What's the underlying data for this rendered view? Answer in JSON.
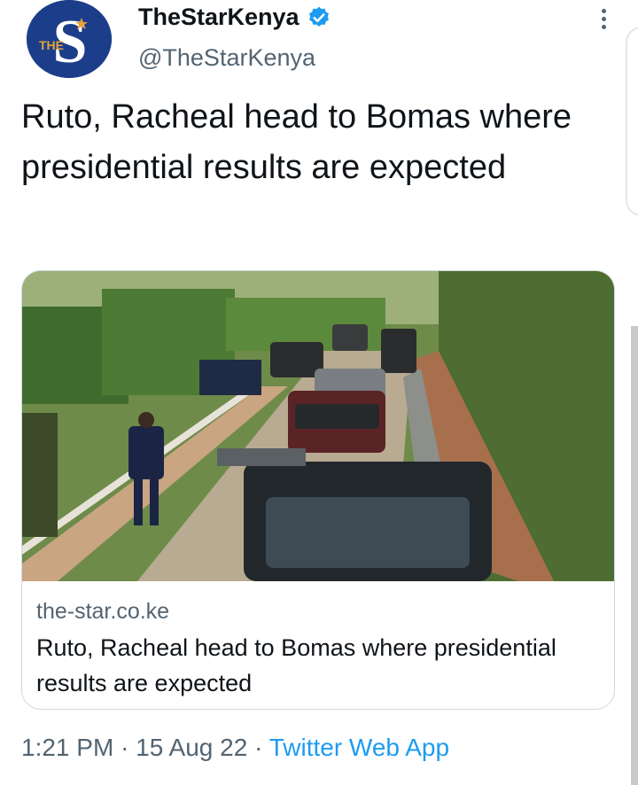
{
  "author": {
    "display_name": "TheStarKenya",
    "handle": "@TheStarKenya",
    "avatar_text": "THE",
    "avatar_letter": "S",
    "verified": true
  },
  "tweet": {
    "text": "Ruto, Racheal head to Bomas where presidential results are expected"
  },
  "card": {
    "domain": "the-star.co.ke",
    "title": "Ruto, Racheal head to Bomas where presidential results are expected"
  },
  "meta": {
    "time": "1:21 PM",
    "separator": "·",
    "date": "15 Aug 22",
    "source": "Twitter Web App"
  },
  "colors": {
    "accent": "#1d9bf0",
    "avatar_bg": "#1c3e8a",
    "secondary_text": "#536471"
  }
}
